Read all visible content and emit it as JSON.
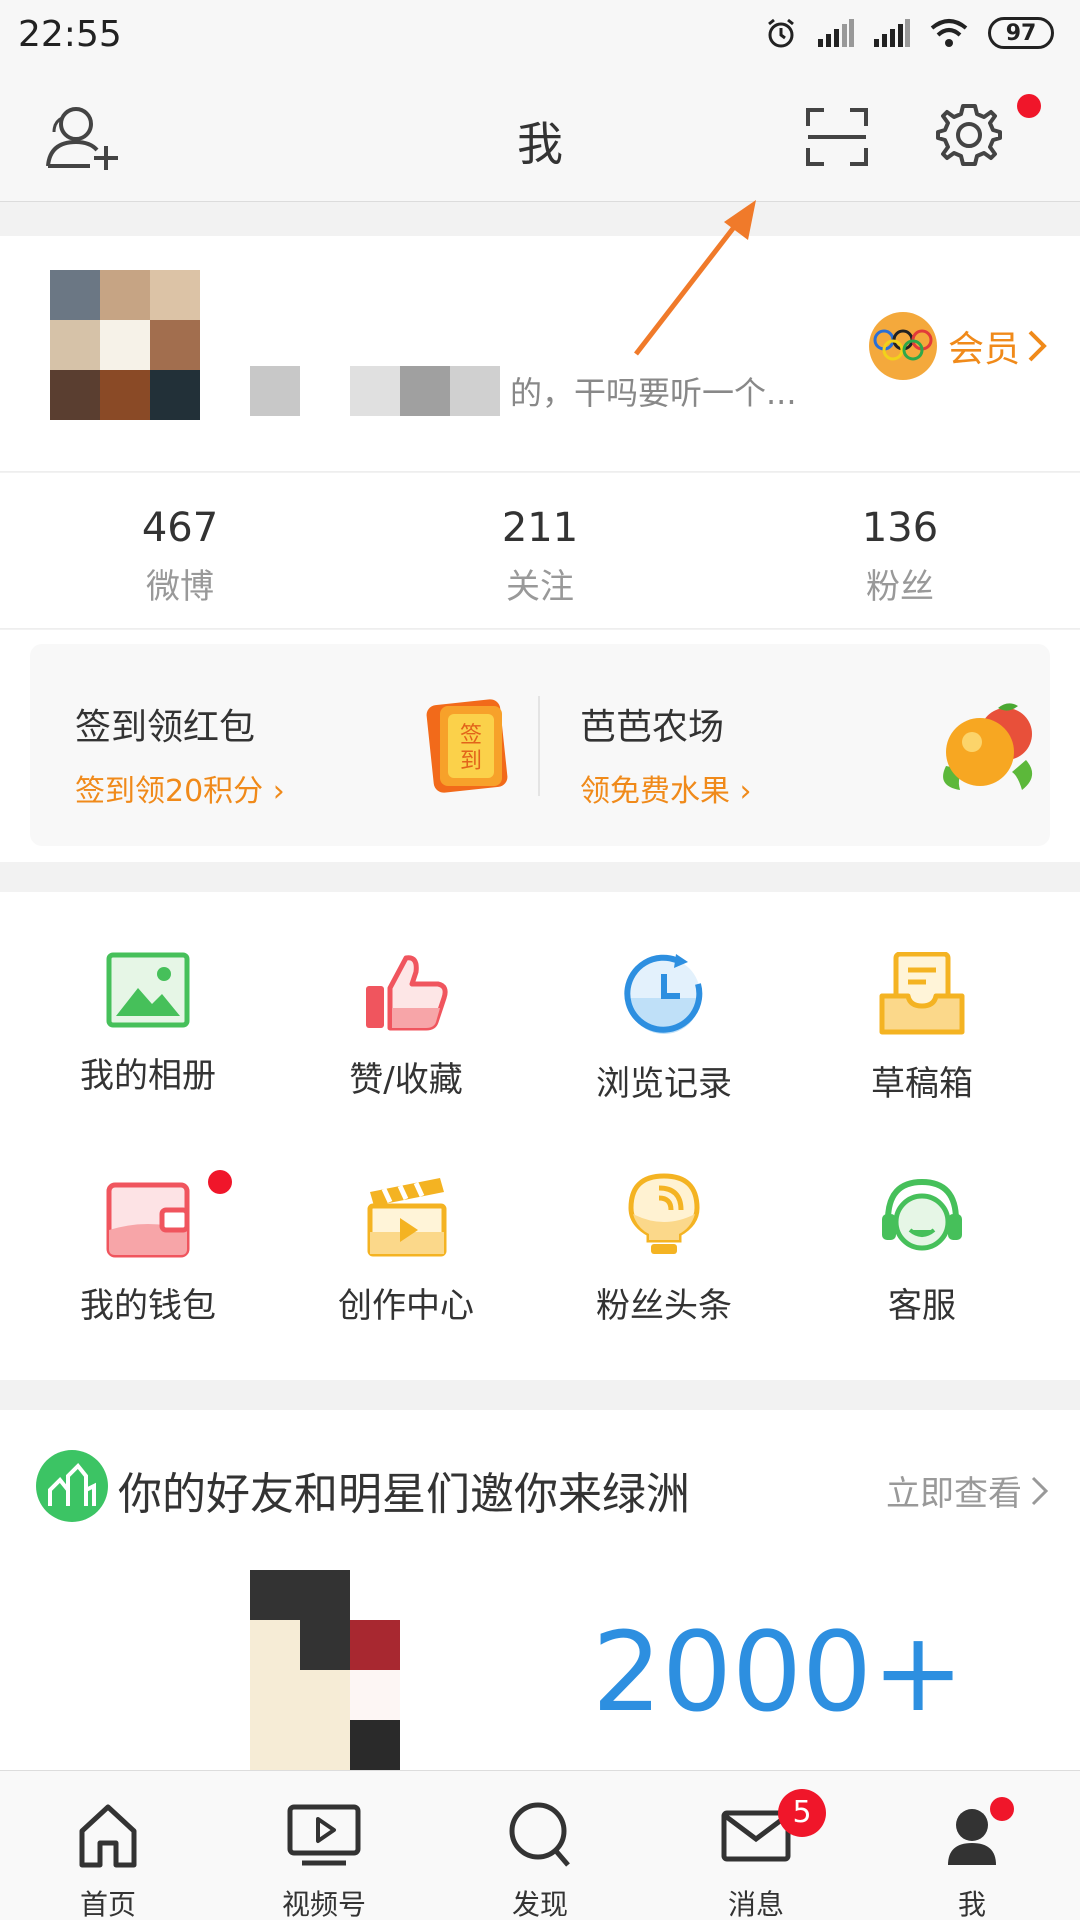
{
  "status_bar": {
    "time": "22:55",
    "battery": "97"
  },
  "header": {
    "title": "我"
  },
  "profile": {
    "bio": "的，干吗要听一个...",
    "vip_label": "会员"
  },
  "stats": [
    {
      "value": "467",
      "label": "微博"
    },
    {
      "value": "211",
      "label": "关注"
    },
    {
      "value": "136",
      "label": "粉丝"
    }
  ],
  "promos": [
    {
      "title": "签到领红包",
      "subtitle": "签到领20积分 ›",
      "badge_text_1": "签",
      "badge_text_2": "到"
    },
    {
      "title": "芭芭农场",
      "subtitle": "领免费水果 ›"
    }
  ],
  "grid": [
    {
      "label": "我的相册",
      "icon": "photo-album-icon"
    },
    {
      "label": "赞/收藏",
      "icon": "thumbs-up-icon"
    },
    {
      "label": "浏览记录",
      "icon": "history-clock-icon"
    },
    {
      "label": "草稿箱",
      "icon": "draft-box-icon"
    },
    {
      "label": "我的钱包",
      "icon": "wallet-icon"
    },
    {
      "label": "创作中心",
      "icon": "creator-clapper-icon"
    },
    {
      "label": "粉丝头条",
      "icon": "lightbulb-icon"
    },
    {
      "label": "客服",
      "icon": "headset-icon"
    }
  ],
  "oasis": {
    "title": "你的好友和明星们邀你来绿洲",
    "link": "立即查看",
    "count": "2000+"
  },
  "bottom_nav": [
    {
      "label": "首页",
      "icon": "home-icon"
    },
    {
      "label": "视频号",
      "icon": "video-icon"
    },
    {
      "label": "发现",
      "icon": "search-icon"
    },
    {
      "label": "消息",
      "icon": "mail-icon",
      "badge": "5"
    },
    {
      "label": "我",
      "icon": "profile-icon"
    }
  ],
  "colors": {
    "accent_orange": "#f08a1a",
    "red_dot": "#f0162a",
    "count_blue": "#2d8fe0",
    "annotation_arrow": "#f07a2a"
  }
}
